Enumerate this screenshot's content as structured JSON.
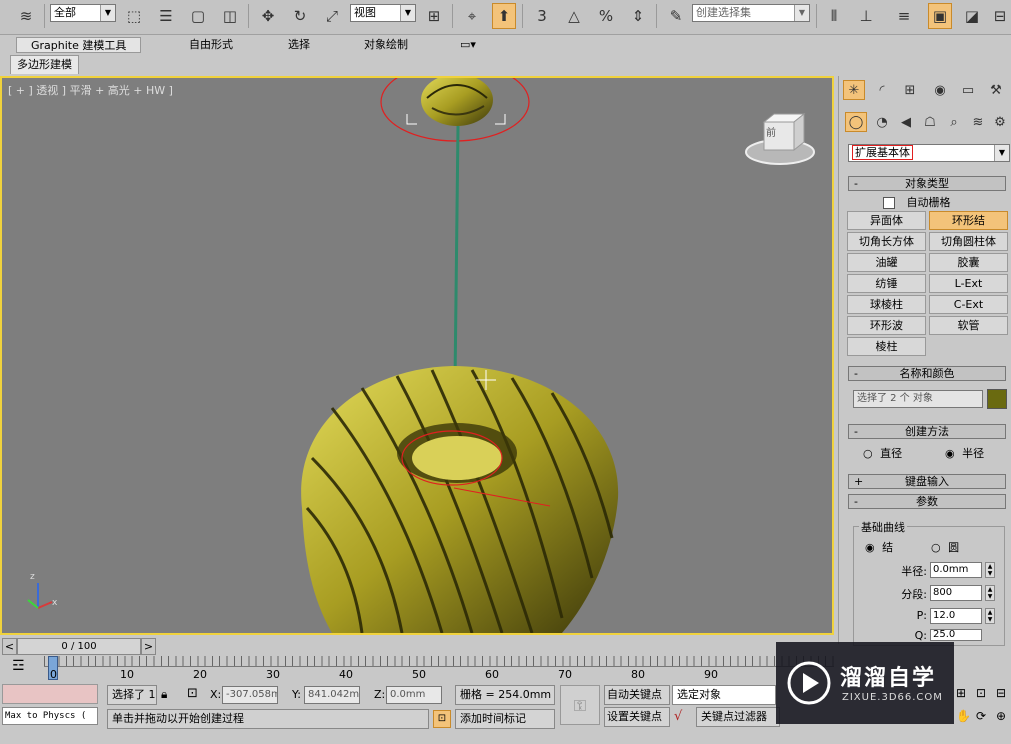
{
  "toolbar": {
    "filter": "全部",
    "ref_coord": "视图",
    "named_selection": "创建选择集",
    "snap_3": "3",
    "angle_snap": "△",
    "percent": "%"
  },
  "ribbon": {
    "tabs": [
      "Graphite 建模工具",
      "自由形式",
      "选择",
      "对象绘制"
    ],
    "subtab": "多边形建模"
  },
  "viewport": {
    "label": "[ + ] 透视 ] 平滑 + 高光 + HW ]",
    "gizmo_z": "z",
    "gizmo_x": "x",
    "viewcube_face": "前"
  },
  "panel": {
    "category": "扩展基本体",
    "object_type_title": "对象类型",
    "autogrid": "自动栅格",
    "buttons": [
      "异面体",
      "环形结",
      "切角长方体",
      "切角圆柱体",
      "油罐",
      "胶囊",
      "纺锤",
      "L-Ext",
      "球棱柱",
      "C-Ext",
      "环形波",
      "软管",
      "棱柱"
    ],
    "active_button": "环形结",
    "name_color_title": "名称和颜色",
    "name_value": "选择了 2 个 对象",
    "object_color": "#6a6a10",
    "creation_title": "创建方法",
    "diameter": "直径",
    "radius": "半径",
    "keyboard_title": "键盘输入",
    "params_title": "参数",
    "base_curve": "基础曲线",
    "knot": "结",
    "circle": "圆",
    "radius_label": "半径:",
    "radius_value": "0.0mm",
    "segments_label": "分段:",
    "segments_value": "800",
    "p_label": "P:",
    "p_value": "12.0",
    "q_label": "Q:",
    "q_value": "25.0"
  },
  "timeline": {
    "frame": "0 / 100",
    "prev": "<",
    "next": ">",
    "ticks": [
      "0",
      "10",
      "20",
      "30",
      "40",
      "50",
      "60",
      "70",
      "80",
      "90"
    ]
  },
  "status": {
    "script_listener": "Max to Physcs (",
    "selected": "选择了 1",
    "x_label": "X:",
    "x_value": "-307.058m",
    "y_label": "Y:",
    "y_value": "841.042mm",
    "z_label": "Z:",
    "z_value": "0.0mm",
    "grid": "栅格 = 254.0mm",
    "auto_key": "自动关键点",
    "selected_object": "选定对象",
    "set_key": "设置关键点",
    "key_filters": "关键点过滤器",
    "prompt": "单击并拖动以开始创建过程",
    "add_time_tag": "添加时间标记"
  },
  "watermark": {
    "title": "溜溜自学",
    "url": "ZIXUE.3D66.COM"
  },
  "colors": {
    "viewport_bg": "#7e7e7e",
    "viewport_border": "#f0d23c",
    "object": "#c8bf3c",
    "active": "#f3c37a",
    "selection_ellipse": "#e02020"
  }
}
